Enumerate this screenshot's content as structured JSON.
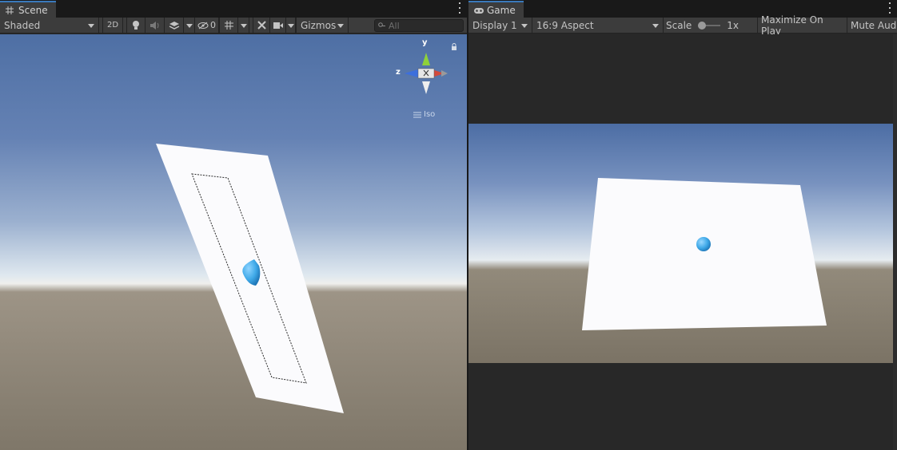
{
  "scene": {
    "tab_label": "Scene",
    "tab_icon": "grid-icon",
    "shading_mode": "Shaded",
    "toggle_2d_label": "2D",
    "hidden_count": "0",
    "gizmos_label": "Gizmos",
    "search_placeholder": "All",
    "gizmo": {
      "y_label": "y",
      "z_label": "z",
      "projection_label": "Iso"
    },
    "colors": {
      "sky_top": "#4e6fa4",
      "horizon": "#efefed",
      "ground": "#7f7769",
      "plane": "#ffffff",
      "sphere": "#3fa9e8",
      "gizmo_y": "#8ed13a",
      "gizmo_x": "#d24a3c",
      "gizmo_z": "#3d6fdc"
    }
  },
  "game": {
    "tab_label": "Game",
    "tab_icon": "gamepad-icon",
    "display_label": "Display 1",
    "aspect_label": "16:9 Aspect",
    "scale_label": "Scale",
    "scale_value": "1x",
    "scale_slider_level": 0.0,
    "maximize_label": "Maximize On Play",
    "mute_label": "Mute Aud"
  }
}
